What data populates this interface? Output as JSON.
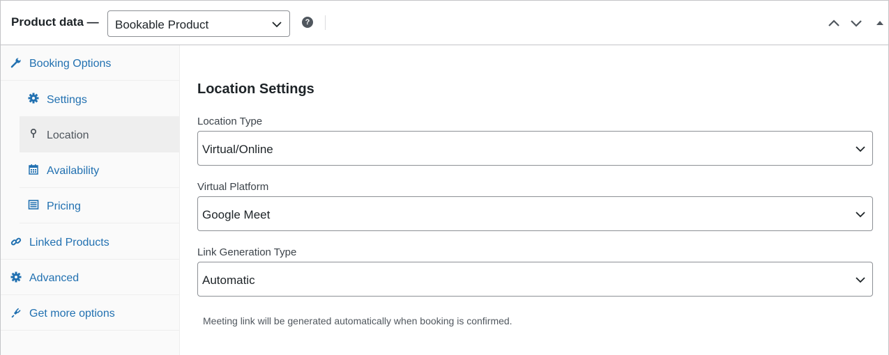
{
  "header": {
    "title": "Product data —",
    "product_type": "Bookable Product",
    "help_icon": "help-circle-icon",
    "move_up_icon": "chevron-up-icon",
    "move_down_icon": "chevron-down-icon",
    "toggle_icon": "triangle-up-icon"
  },
  "sidebar": {
    "items": [
      {
        "label": "Booking Options",
        "icon": "wrench-icon"
      },
      {
        "label": "Settings",
        "icon": "gear-icon"
      },
      {
        "label": "Location",
        "icon": "map-pin-icon",
        "active": true
      },
      {
        "label": "Availability",
        "icon": "calendar-icon"
      },
      {
        "label": "Pricing",
        "icon": "list-icon"
      },
      {
        "label": "Linked Products",
        "icon": "link-icon"
      },
      {
        "label": "Advanced",
        "icon": "gear-icon"
      },
      {
        "label": "Get more options",
        "icon": "plugin-icon"
      }
    ]
  },
  "main": {
    "heading": "Location Settings",
    "fields": [
      {
        "label": "Location Type",
        "value": "Virtual/Online"
      },
      {
        "label": "Virtual Platform",
        "value": "Google Meet"
      },
      {
        "label": "Link Generation Type",
        "value": "Automatic"
      }
    ],
    "description": "Meeting link will be generated automatically when booking is confirmed."
  },
  "colors": {
    "link": "#2271b1",
    "text": "#1d2327",
    "muted": "#50575e",
    "border": "#8c8f94",
    "active_bg": "#eeeeee",
    "sidebar_bg": "#fafafa"
  }
}
